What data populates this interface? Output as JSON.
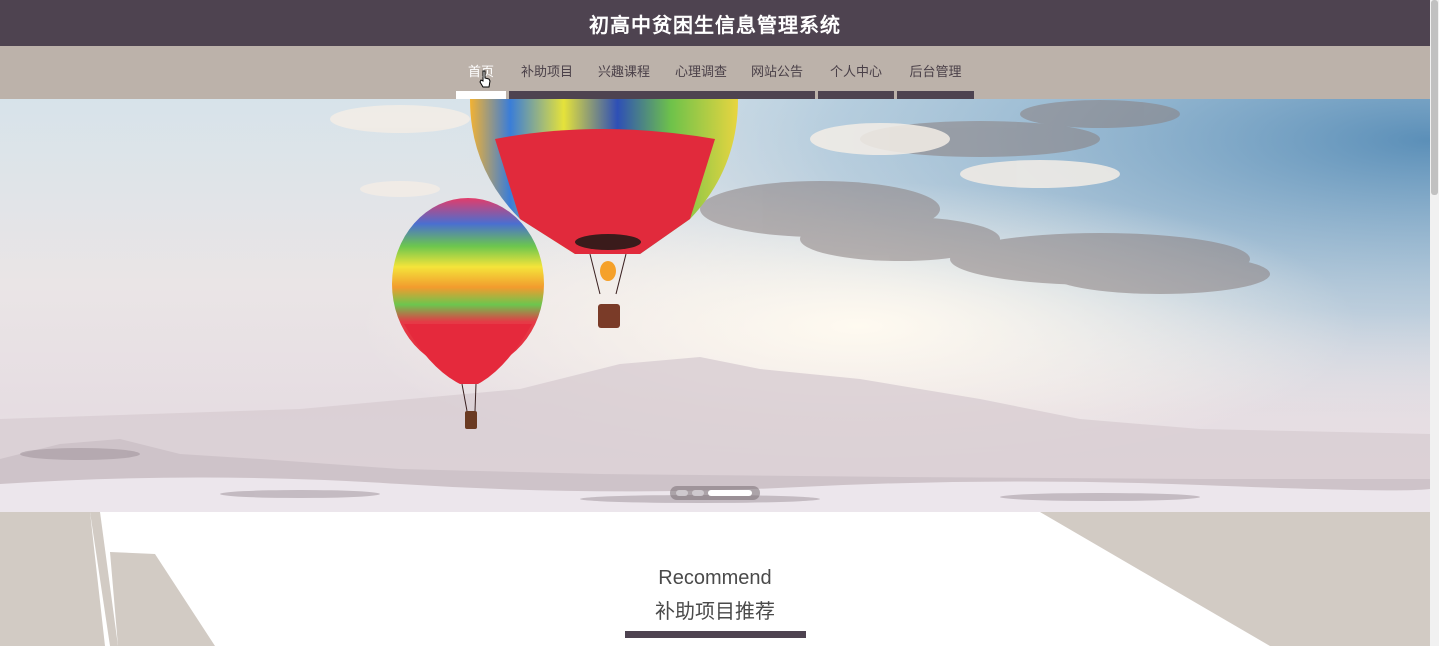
{
  "header": {
    "title": "初高中贫困生信息管理系统"
  },
  "nav": {
    "items": [
      {
        "label": "首页",
        "active": true
      },
      {
        "label": "补助项目",
        "active": false
      },
      {
        "label": "兴趣课程",
        "active": false
      },
      {
        "label": "心理调查",
        "active": false
      },
      {
        "label": "网站公告",
        "active": false
      },
      {
        "label": "个人中心",
        "active": false
      },
      {
        "label": "后台管理",
        "active": false
      }
    ]
  },
  "banner": {
    "slide_count": 3,
    "active_slide": 3
  },
  "section": {
    "title_en": "Recommend",
    "title_cn": "补助项目推荐"
  },
  "colors": {
    "header_bg": "#4e4350",
    "nav_bg": "#bcb2aa",
    "section_bg": "#d2cbc4",
    "accent": "#4e4350"
  }
}
